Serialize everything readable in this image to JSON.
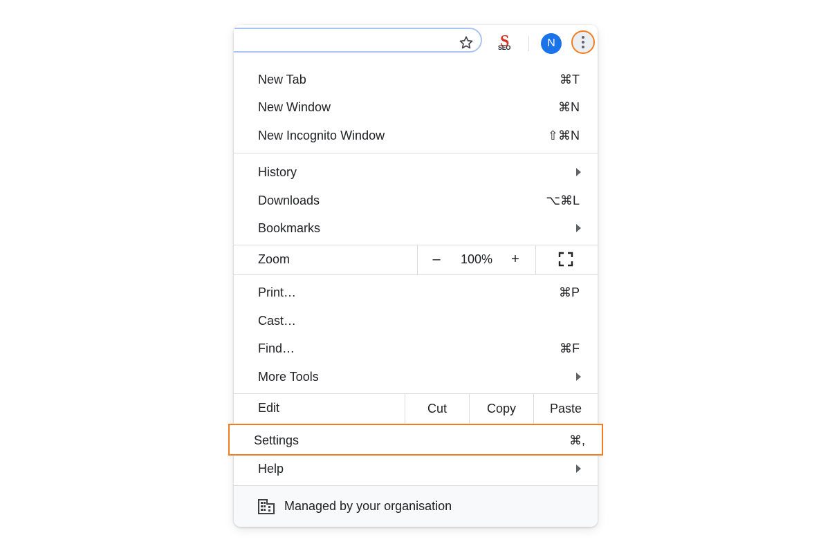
{
  "toolbar": {
    "extension_s": "S",
    "extension_text": "SEO",
    "avatar_letter": "N",
    "icons": [
      "star-icon",
      "seo-extension-icon",
      "avatar",
      "more-menu-icon"
    ],
    "accent_color": "#f27b1f"
  },
  "menu": {
    "group1": [
      {
        "label": "New Tab",
        "shortcut": "⌘T"
      },
      {
        "label": "New Window",
        "shortcut": "⌘N"
      },
      {
        "label": "New Incognito Window",
        "shortcut": "⇧⌘N"
      }
    ],
    "group2": [
      {
        "label": "History",
        "submenu": true
      },
      {
        "label": "Downloads",
        "shortcut": "⌥⌘L"
      },
      {
        "label": "Bookmarks",
        "submenu": true
      }
    ],
    "zoom": {
      "label": "Zoom",
      "minus": "–",
      "value": "100%",
      "plus": "+",
      "fullscreen_icon": "fullscreen-icon"
    },
    "group3": [
      {
        "label": "Print…",
        "shortcut": "⌘P"
      },
      {
        "label": "Cast…"
      },
      {
        "label": "Find…",
        "shortcut": "⌘F"
      },
      {
        "label": "More Tools",
        "submenu": true
      }
    ],
    "edit": {
      "label": "Edit",
      "cut": "Cut",
      "copy": "Copy",
      "paste": "Paste"
    },
    "settings": {
      "label": "Settings",
      "shortcut": "⌘,",
      "highlighted": true
    },
    "help": {
      "label": "Help",
      "submenu": true
    },
    "managed": {
      "label": "Managed by your organisation",
      "icon": "building-icon"
    }
  }
}
